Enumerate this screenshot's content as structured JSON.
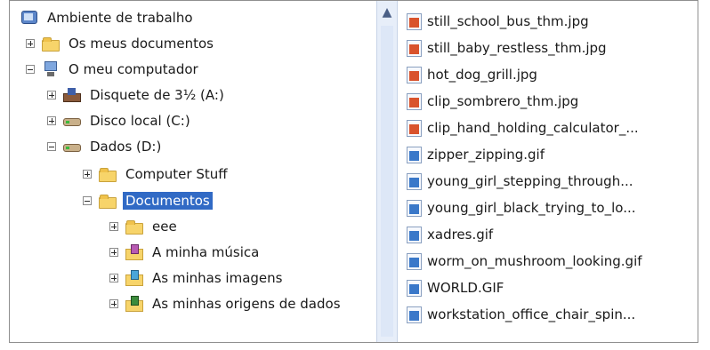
{
  "tree": {
    "nodes": [
      {
        "label": "Ambiente de trabalho",
        "icon": "desktop-icon"
      },
      {
        "label": "Os meus documentos",
        "icon": "my-documents-folder-icon"
      },
      {
        "label": "O meu computador",
        "icon": "my-computer-icon"
      },
      {
        "label": "Disquete de 3½ (A:)",
        "icon": "floppy-drive-icon"
      },
      {
        "label": "Disco local (C:)",
        "icon": "hard-drive-icon"
      },
      {
        "label": "Dados (D:)",
        "icon": "hard-drive-icon"
      },
      {
        "label": "Computer Stuff",
        "icon": "folder-icon"
      },
      {
        "label": "Documentos",
        "icon": "folder-icon",
        "selected": true
      },
      {
        "label": "eee",
        "icon": "folder-icon"
      },
      {
        "label": "A minha música",
        "icon": "music-folder-icon"
      },
      {
        "label": "As minhas imagens",
        "icon": "pictures-folder-icon"
      },
      {
        "label": "As minhas origens de dados",
        "icon": "data-sources-folder-icon"
      }
    ]
  },
  "scrollbar": {
    "up_arrow": "▲"
  },
  "files": [
    {
      "name": "still_school_bus_thm.jpg",
      "type": "jpg"
    },
    {
      "name": "still_baby_restless_thm.jpg",
      "type": "jpg"
    },
    {
      "name": "hot_dog_grill.jpg",
      "type": "jpg"
    },
    {
      "name": "clip_sombrero_thm.jpg",
      "type": "jpg"
    },
    {
      "name": "clip_hand_holding_calculator_...",
      "type": "jpg"
    },
    {
      "name": "zipper_zipping.gif",
      "type": "gif"
    },
    {
      "name": "young_girl_stepping_through...",
      "type": "gif"
    },
    {
      "name": "young_girl_black_trying_to_lo...",
      "type": "gif"
    },
    {
      "name": "xadres.gif",
      "type": "gif"
    },
    {
      "name": "worm_on_mushroom_looking.gif",
      "type": "gif"
    },
    {
      "name": "WORLD.GIF",
      "type": "gif"
    },
    {
      "name": "workstation_office_chair_spin...",
      "type": "gif"
    }
  ],
  "colors": {
    "selection": "#316ac5",
    "folder": "#f7d46a",
    "scroll_track": "#e7eef9"
  }
}
